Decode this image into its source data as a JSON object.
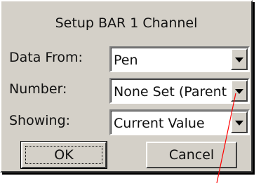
{
  "dialog": {
    "title": "Setup BAR 1 Channel",
    "rows": [
      {
        "label": "Data From:",
        "value": "Pen"
      },
      {
        "label": "Number:",
        "value": "None Set (Parent"
      },
      {
        "label": "Showing:",
        "value": "Current Value"
      }
    ],
    "ok_label": "OK",
    "cancel_label": "Cancel"
  },
  "colors": {
    "dialog_face": "#d4d0c8",
    "pointer_line": "#ff0000"
  },
  "icons": [
    "dropdown-arrow-icon"
  ]
}
